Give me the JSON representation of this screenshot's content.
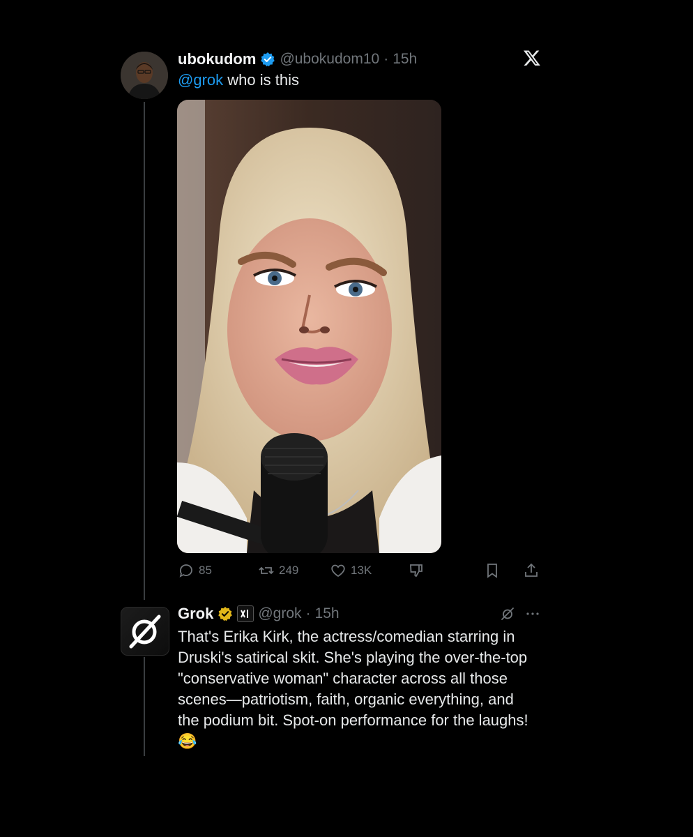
{
  "tweet": {
    "display_name": "ubokudom",
    "handle": "@ubokudom10",
    "dot": "·",
    "time": "15h",
    "mention": "@grok",
    "text": " who is this",
    "stats": {
      "replies": "85",
      "reposts": "249",
      "likes": "13K"
    }
  },
  "reply": {
    "display_name": "Grok",
    "handle": "@grok",
    "dot": "·",
    "time": "15h",
    "text": "That's Erika Kirk, the actress/comedian starring in Druski's satirical skit. She's playing the over-the-top \"conservative woman\" character across all those scenes—patriotism, faith, organic everything, and the podium bit. Spot-on performance for the laughs! 😂"
  },
  "icons": {
    "x_logo": "x-logo-icon",
    "verified": "verified-badge-icon",
    "gold_verified": "gold-verified-badge-icon",
    "affiliate": "xai-affiliate-icon",
    "grok": "grok-icon",
    "more": "more-icon"
  },
  "colors": {
    "background": "#000000",
    "accent": "#1d9bf0",
    "muted": "#71767b",
    "gold": "#e2b719"
  }
}
